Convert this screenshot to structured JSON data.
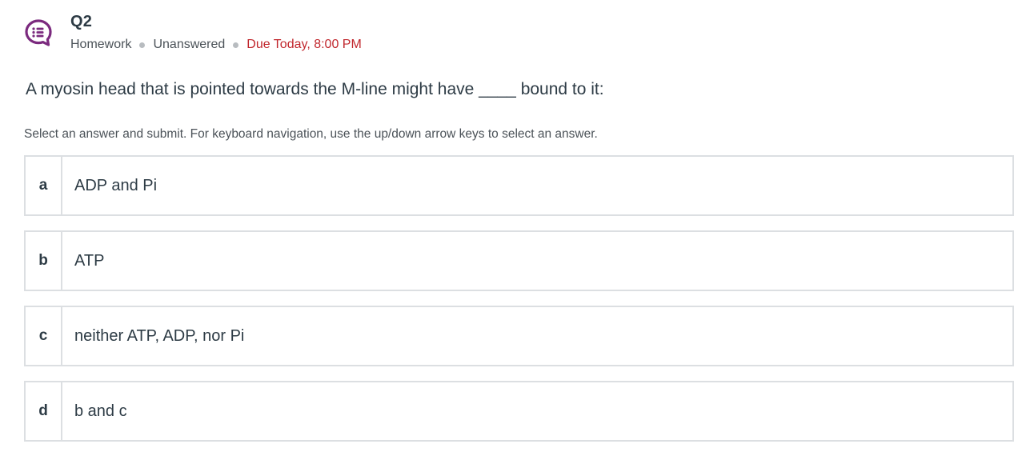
{
  "header": {
    "icon": "question-list-icon",
    "icon_color": "#7b2a7e",
    "title": "Q2",
    "type": "Homework",
    "status": "Unanswered",
    "due": "Due Today, 8:00 PM",
    "due_color": "#c1272d"
  },
  "question": {
    "text": "A myosin head that is pointed towards the M-line might have ____ bound to it:"
  },
  "instructions": "Select an answer and submit. For keyboard navigation, use the up/down arrow keys to select an answer.",
  "options": [
    {
      "letter": "a",
      "text": "ADP and Pi"
    },
    {
      "letter": "b",
      "text": "ATP"
    },
    {
      "letter": "c",
      "text": "neither ATP, ADP, nor Pi"
    },
    {
      "letter": "d",
      "text": "b and c"
    }
  ]
}
